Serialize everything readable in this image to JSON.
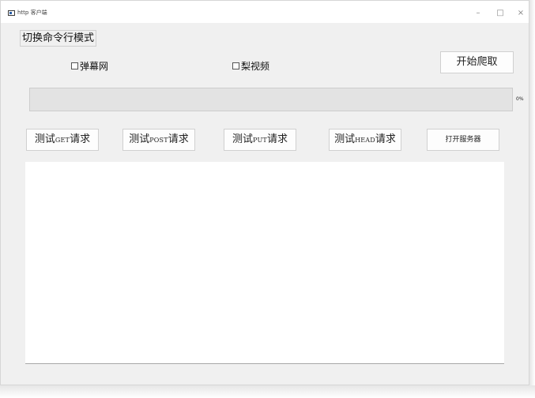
{
  "window": {
    "title": "http 客户端",
    "controls": {
      "minimize": "–",
      "maximize": "□",
      "close": "×"
    }
  },
  "toolbar": {
    "mode_toggle_label": "切换命令行模式"
  },
  "options": {
    "danmu_label": "弹幕网",
    "danmu_checked": false,
    "video_label": "梨视频",
    "video_checked": false
  },
  "crawl": {
    "start_label": "开始爬取",
    "progress_percent": 0,
    "progress_text": "0%"
  },
  "tests": {
    "prefix": "测试",
    "suffix": "请求",
    "get": "GET",
    "post": "POST",
    "put": "PUT",
    "head": "HEAD",
    "open_server_label": "打开服务器"
  },
  "output": {
    "text": ""
  }
}
